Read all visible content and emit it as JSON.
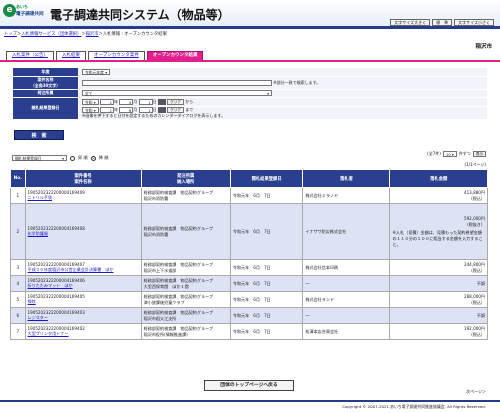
{
  "header": {
    "logo_mark": "e",
    "logo_sub": "あいち",
    "logo_name": "電子調達共同",
    "title": "電子調達共同システム（物品等）",
    "font_buttons": [
      "文字サイズ大きく",
      "標　準",
      "文字サイズ小さく"
    ]
  },
  "breadcrumb": {
    "top": "トップ",
    "sep1": "＞",
    "service": "入札情報サービス（団体選択）",
    "sep2": "＞",
    "city": "稲沢市",
    "sep3": "＞",
    "current": "入札情報 : オープンカウンタ結果"
  },
  "tabs": [
    "入札案件（公告）",
    "入札結果",
    "オープンカウンタ案件",
    "オープンカウンタ結果"
  ],
  "org_name": "稲沢市",
  "form": {
    "year_label": "年度",
    "year_value": "令和元年度",
    "case_name_label": "案件名称",
    "case_name_sub": "（全角30文字）",
    "case_name_hint": "※部分一致で検索します。",
    "dept_label": "発注所属",
    "dept_value": "全て",
    "date_label": "開札結果登録日",
    "era": "令和",
    "from": {
      "y": "1",
      "m": "4",
      "d": "1"
    },
    "to": {
      "y": "1",
      "m": "6",
      "d": "1"
    },
    "unit_y": "年",
    "unit_m": "月",
    "unit_d": "日",
    "clear": "クリア",
    "kara": "から",
    "made": "まで",
    "calendar_hint": "※画像を押下すると日付を設定するためのカレンダーダイアログを表示します。"
  },
  "search_button": "検　索",
  "sort": {
    "select_value": "開札結果登録日",
    "asc": "昇 順",
    "desc": "降 順",
    "selected": "desc"
  },
  "paging": {
    "count_label": "(全7件)",
    "per_page": "10",
    "unit": "件ずつ",
    "show": "表示",
    "pages": "(1/1ページ)",
    "next": "次ページ＞"
  },
  "table": {
    "headers": {
      "no": "No.",
      "case": [
        "案件番号",
        "案件名称"
      ],
      "dept": [
        "発注所属",
        "納入場所"
      ],
      "date": "開札結果登録日",
      "winner": "落札者",
      "amount": "落札金額"
    },
    "rows": [
      {
        "no": "1",
        "case_no": "1905202322200004169409",
        "case_name": "ニトリル手袋",
        "dept": "総務部契約検査課　物品契約グループ",
        "place": "稲沢市消防署",
        "date": "令和元年　6月　7日",
        "winner": "株式会社ミラノヤ",
        "amount": "413,880円",
        "tax": "（税込）",
        "note": ""
      },
      {
        "no": "2",
        "case_no": "1905202322200004169408",
        "case_name": "化学防護服",
        "dept": "総務部契約検査課　物品契約グループ",
        "place": "稲沢市消防署",
        "date": "令和元年　6月　7日",
        "winner": "イナザワ防災株式会社",
        "amount": "592,000円",
        "tax": "（税抜き）",
        "note": "※入札（見積）金額は、見積もった契約希望金額の１１０分の１００に相当する金額を入力すること。"
      },
      {
        "no": "3",
        "case_no": "1905202322200004169407",
        "case_name": "平成３０年度稲沢市公営企業会計決算書　ほか",
        "dept": "総務部契約検査課　物品契約グループ",
        "place": "稲沢市上下水道部",
        "date": "令和元年　6月　7日",
        "winner": "株式会社信本印刷",
        "amount": "244,800円",
        "tax": "（税込）",
        "note": ""
      },
      {
        "no": "4",
        "case_no": "1905202322200004169406",
        "case_name": "折りたたみマット　ほか",
        "dept": "総務部契約検査課　物品契約グループ",
        "place": "大里西保育園　ほか１園",
        "date": "令和元年　6月　7日",
        "winner": "―",
        "amount": "不調",
        "tax": "",
        "note": ""
      },
      {
        "no": "5",
        "case_no": "1905202322200004169405",
        "case_name": "掃除",
        "dept": "総務部契約検査課　物品契約グループ",
        "place": "津小放課後児童クラブ",
        "date": "令和元年　6月　7日",
        "winner": "株式会社ランド",
        "amount": "288,000円",
        "tax": "（税込）",
        "note": ""
      },
      {
        "no": "6",
        "case_no": "1905202322200004169403",
        "case_name": "レジスター",
        "dept": "総務部契約検査課　物品契約グループ",
        "place": "稲沢市祖父江支所",
        "date": "令和元年　6月　7日",
        "winner": "―",
        "amount": "不調",
        "tax": "",
        "note": ""
      },
      {
        "no": "7",
        "case_no": "1905202322200004169402",
        "case_name": "大型プリンタ用トナー",
        "dept": "総務部契約検査課　物品契約グループ",
        "place": "稲沢市役所(情報推進課)",
        "date": "令和元年　6月　7日",
        "winner": "松澤本店合資会社",
        "amount": "192,000円",
        "tax": "（税込）",
        "note": ""
      }
    ]
  },
  "back_button": "団体のトップページへ戻る",
  "footer": "Copyright © 2007-2021 あいち電子調達共同推進協議会. All Rights Reserved."
}
